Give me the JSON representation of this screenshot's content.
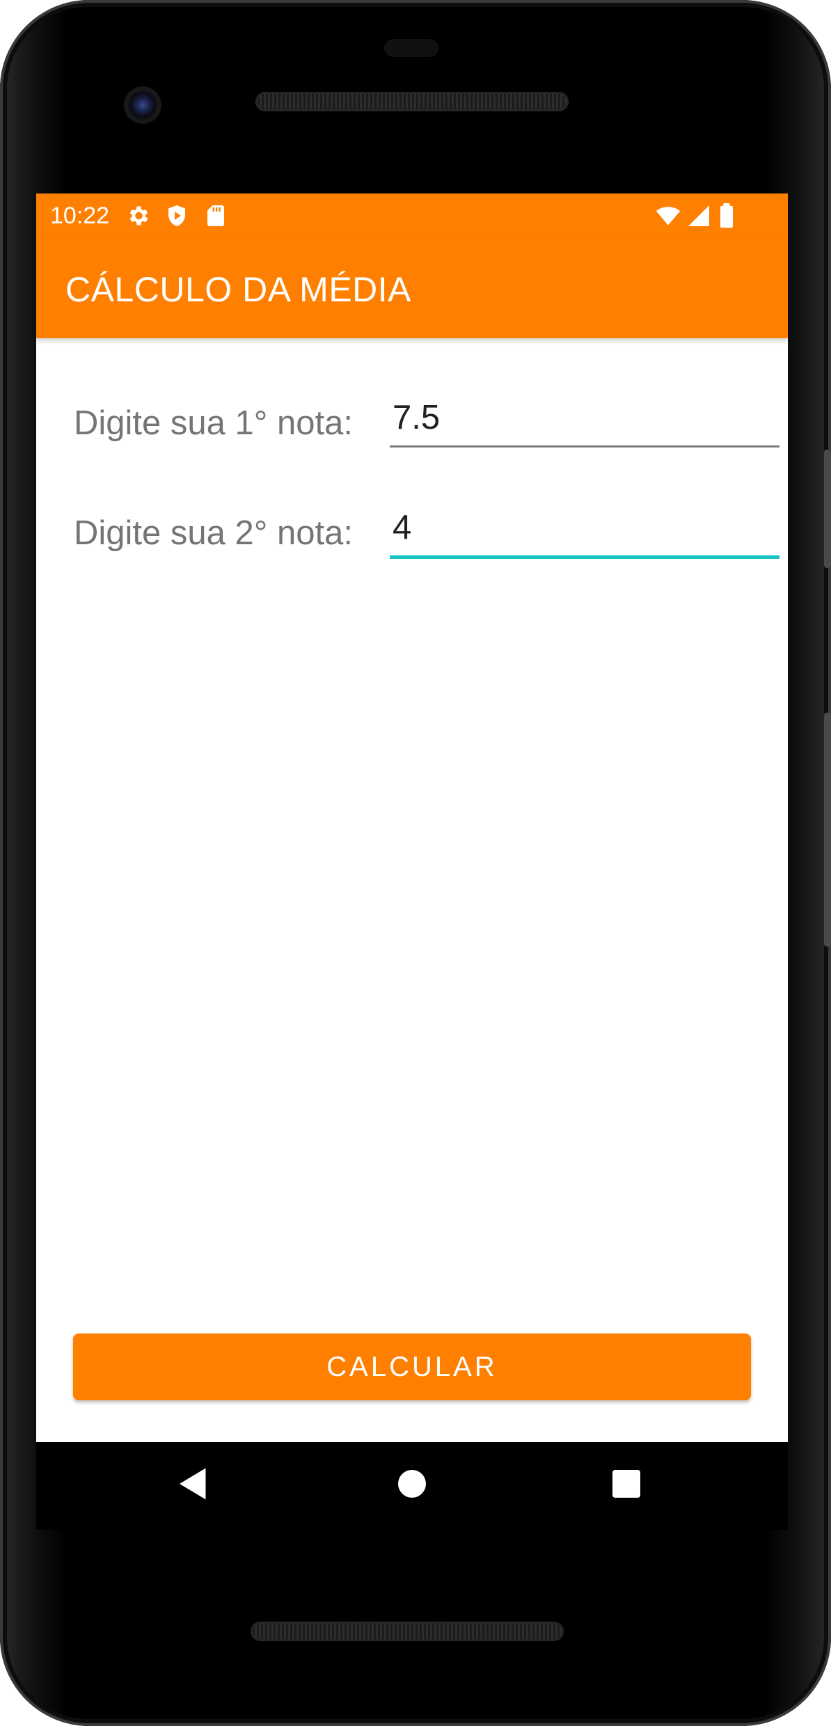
{
  "status_bar": {
    "time": "10:22",
    "left_icons": [
      "gear-icon",
      "shield-play-icon",
      "sd-card-icon"
    ],
    "right_icons": [
      "wifi-icon",
      "cell-signal-icon",
      "battery-icon"
    ]
  },
  "app_bar": {
    "title": "CÁLCULO DA MÉDIA"
  },
  "form": {
    "grade1": {
      "label": "Digite sua 1° nota:",
      "value": "7.5"
    },
    "grade2": {
      "label": "Digite sua 2° nota:",
      "value": "4"
    }
  },
  "actions": {
    "calculate_label": "CALCULAR"
  },
  "nav_bar": {
    "buttons": [
      "back-icon",
      "home-icon",
      "recents-icon"
    ]
  },
  "colors": {
    "primary": "#FF7F00",
    "focus_accent": "#18C4C4",
    "label_gray": "#757575",
    "text": "#212121"
  }
}
